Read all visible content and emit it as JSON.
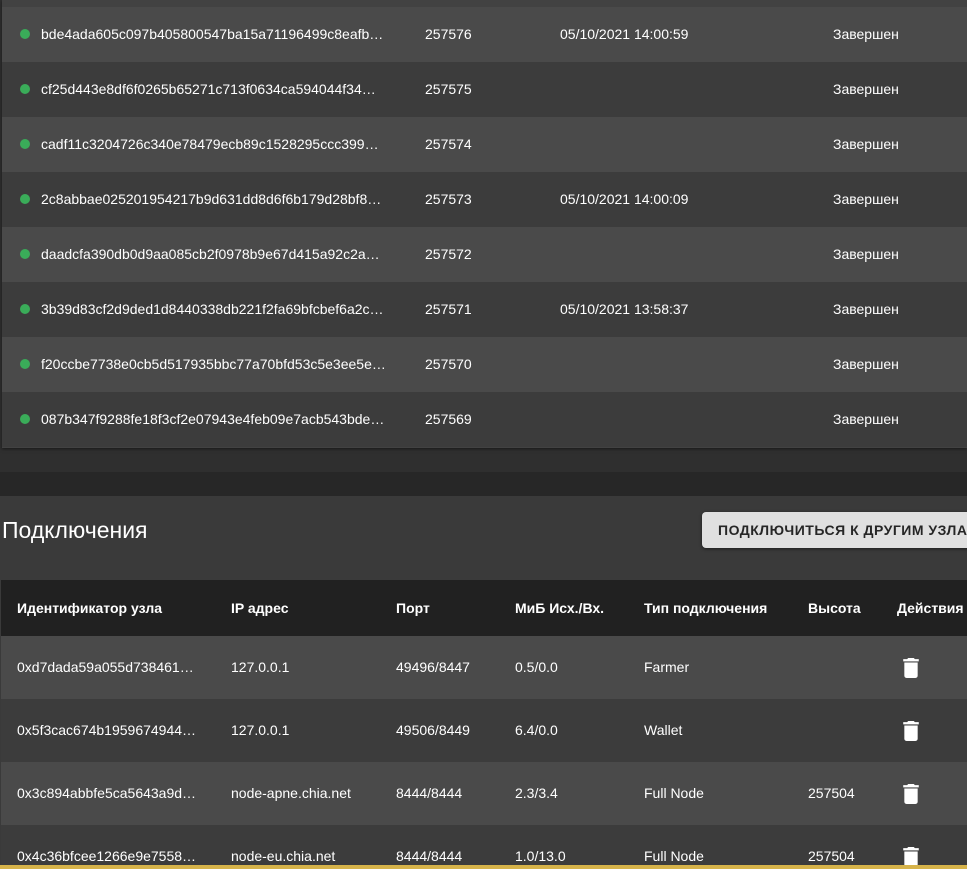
{
  "blocks": {
    "rows": [
      {
        "hash": "bde4ada605c097b405800547ba15a71196499c8eafb…",
        "height": "257576",
        "time": "05/10/2021 14:00:59",
        "state": "Завершен"
      },
      {
        "hash": "cf25d443e8df6f0265b65271c713f0634ca594044f34…",
        "height": "257575",
        "time": "",
        "state": "Завершен"
      },
      {
        "hash": "cadf11c3204726c340e78479ecb89c1528295ccc399…",
        "height": "257574",
        "time": "",
        "state": "Завершен"
      },
      {
        "hash": "2c8abbae025201954217b9d631dd8d6f6b179d28bf8…",
        "height": "257573",
        "time": "05/10/2021 14:00:09",
        "state": "Завершен"
      },
      {
        "hash": "daadcfa390db0d9aa085cb2f0978b9e67d415a92c2a…",
        "height": "257572",
        "time": "",
        "state": "Завершен"
      },
      {
        "hash": "3b39d83cf2d9ded1d8440338db221f2fa69bfcbef6a2c…",
        "height": "257571",
        "time": "05/10/2021 13:58:37",
        "state": "Завершен"
      },
      {
        "hash": "f20ccbe7738e0cb5d517935bbc77a70bfd53c5e3ee5e…",
        "height": "257570",
        "time": "",
        "state": "Завершен"
      },
      {
        "hash": "087b347f9288fe18f3cf2e07943e4feb09e7acb543bde…",
        "height": "257569",
        "time": "",
        "state": "Завершен"
      }
    ],
    "status_color": "#3aac59"
  },
  "connections": {
    "title": "Подключения",
    "connect_button_label": "ПОДКЛЮЧИТЬСЯ К ДРУГИМ УЗЛАМ",
    "columns": {
      "node_id": "Идентификатор узла",
      "ip": "IP адрес",
      "port": "Порт",
      "mib": "МиБ Исх./Вх.",
      "type": "Тип подключения",
      "height": "Высота",
      "actions": "Действия"
    },
    "rows": [
      {
        "node_id": "0xd7dada59a055d738461…",
        "ip": "127.0.0.1",
        "port": "49496/8447",
        "mib": "0.5/0.0",
        "type": "Farmer",
        "height": "",
        "action_icon": "trash-icon"
      },
      {
        "node_id": "0x5f3cac674b1959674944…",
        "ip": "127.0.0.1",
        "port": "49506/8449",
        "mib": "6.4/0.0",
        "type": "Wallet",
        "height": "",
        "action_icon": "trash-icon"
      },
      {
        "node_id": "0x3c894abbfe5ca5643a9d…",
        "ip": "node-apne.chia.net",
        "port": "8444/8444",
        "mib": "2.3/3.4",
        "type": "Full Node",
        "height": "257504",
        "action_icon": "trash-icon"
      },
      {
        "node_id": "0x4c36bfcee1266e9e7558…",
        "ip": "node-eu.chia.net",
        "port": "8444/8444",
        "mib": "1.0/13.0",
        "type": "Full Node",
        "height": "257504",
        "action_icon": "trash-icon"
      }
    ]
  }
}
